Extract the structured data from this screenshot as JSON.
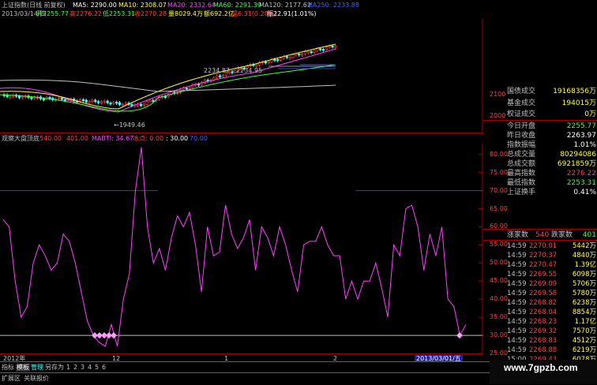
{
  "main_chart": {
    "title": "上证指数(日线 前复权)",
    "ma5": "MA5: 2290.00",
    "ma10": "MA10: 2308.07",
    "ma20": "MA20: 2332.64",
    "ma60": "MA60: 2291.39",
    "ma120": "MA120: 2177.62",
    "ma250": "MA250: 2233.88",
    "date": "2013/03/14/四",
    "open": "开2255.77",
    "high": "高2276.22",
    "low": "低2253.31",
    "close": "收2270.28",
    "volume": "量8029.4万",
    "amount": "额692.2亿",
    "change": "幅6.31(0.28%)",
    "amplitude": "振22.91(1.01%)",
    "annotation_high": "2234.87 - 2234.95",
    "annotation_low": "←1949.46",
    "y_ticks": [
      "2100",
      "2000"
    ]
  },
  "indicator": {
    "name": "观察大盘顶底",
    "v1": "540.00",
    "v2": "401.00",
    "mabti": "MABTI: 34.67",
    "ice": "冰点: 0.00",
    "v3": ": 30.00",
    "v4": "70.00",
    "y_ticks": [
      "80.00",
      "75.00",
      "70.00",
      "65.00",
      "60.00",
      "55.00",
      "50.00",
      "45.00",
      "40.00",
      "35.00",
      "30.00",
      "25.00"
    ]
  },
  "chart_data": {
    "type": "line",
    "title": "观察大盘顶底",
    "xlabel": "",
    "ylabel": "",
    "ylim": [
      25,
      83
    ],
    "reference_lines": [
      70,
      30
    ],
    "series": [
      {
        "name": "MABTI",
        "values": [
          62,
          60,
          45,
          35,
          38,
          50,
          55,
          52,
          48,
          50,
          58,
          56,
          50,
          42,
          34,
          30,
          28,
          27,
          33,
          27,
          40,
          47,
          70,
          82,
          60,
          50,
          54,
          48,
          57,
          63,
          60,
          64,
          55,
          42,
          60,
          52,
          53,
          66,
          58,
          54,
          57,
          62,
          48,
          60,
          57,
          52,
          60,
          55,
          48,
          42,
          55,
          56,
          56,
          60,
          55,
          52,
          52,
          40,
          45,
          40,
          45,
          45,
          50,
          43,
          35,
          55,
          52,
          65,
          66,
          60,
          48,
          58,
          52,
          60,
          40,
          38,
          30,
          33
        ]
      }
    ],
    "x_ticks": [
      "2012年",
      "12",
      "1",
      "2",
      "2013/03/01/五"
    ]
  },
  "stats": [
    {
      "label": "国债成交",
      "value": "19168356万",
      "color": "#ffff40"
    },
    {
      "label": "基金成交",
      "value": "194015万",
      "color": "#ffff40"
    },
    {
      "label": "权证成交",
      "value": "0万",
      "color": "#ffff40"
    },
    {
      "label": "今日开盘",
      "value": "2255.77",
      "color": "#40ff40"
    },
    {
      "label": "昨日收盘",
      "value": "2263.97",
      "color": "#ffffff"
    },
    {
      "label": "指数振幅",
      "value": "1.01%",
      "color": "#ffffff"
    },
    {
      "label": "总成交量",
      "value": "80294086",
      "color": "#ffff40"
    },
    {
      "label": "总成交额",
      "value": "6921859万",
      "color": "#ffff40"
    },
    {
      "label": "最高指数",
      "value": "2276.22",
      "color": "#ff4040"
    },
    {
      "label": "最低指数",
      "value": "2253.31",
      "color": "#40ff40"
    },
    {
      "label": "上证换手",
      "value": "0.41%",
      "color": "#ffffff"
    }
  ],
  "updown": {
    "up_label": "涨家数",
    "up": "540",
    "down_label": "跌家数",
    "down": "401"
  },
  "ticks": [
    {
      "time": "14:59",
      "price": "2270.01",
      "vol": "5442万"
    },
    {
      "time": "14:59",
      "price": "2270.37",
      "vol": "4840万"
    },
    {
      "time": "14:59",
      "price": "2270.47",
      "vol": "1.39亿"
    },
    {
      "time": "14:59",
      "price": "2269.55",
      "vol": "6098万"
    },
    {
      "time": "14:59",
      "price": "2269.09",
      "vol": "5706万"
    },
    {
      "time": "14:59",
      "price": "2269.58",
      "vol": "5780万"
    },
    {
      "time": "14:59",
      "price": "2268.82",
      "vol": "6238万"
    },
    {
      "time": "14:59",
      "price": "2268.04",
      "vol": "8854万"
    },
    {
      "time": "14:59",
      "price": "2268.23",
      "vol": "1.17亿"
    },
    {
      "time": "14:59",
      "price": "2269.32",
      "vol": "7570万"
    },
    {
      "time": "14:59",
      "price": "2268.83",
      "vol": "4512万"
    },
    {
      "time": "14:59",
      "price": "2268.88",
      "vol": "6219万"
    },
    {
      "time": "15:00",
      "price": "2269.43",
      "vol": "6078万"
    }
  ],
  "bottom_tabs": [
    "指标",
    "模板",
    "管理",
    "另存为",
    "1",
    "2",
    "3",
    "4",
    "5",
    "6"
  ],
  "bottom_tabs2": [
    "扩展区",
    "关联报价"
  ],
  "watermark": "www.7gpzb.com"
}
